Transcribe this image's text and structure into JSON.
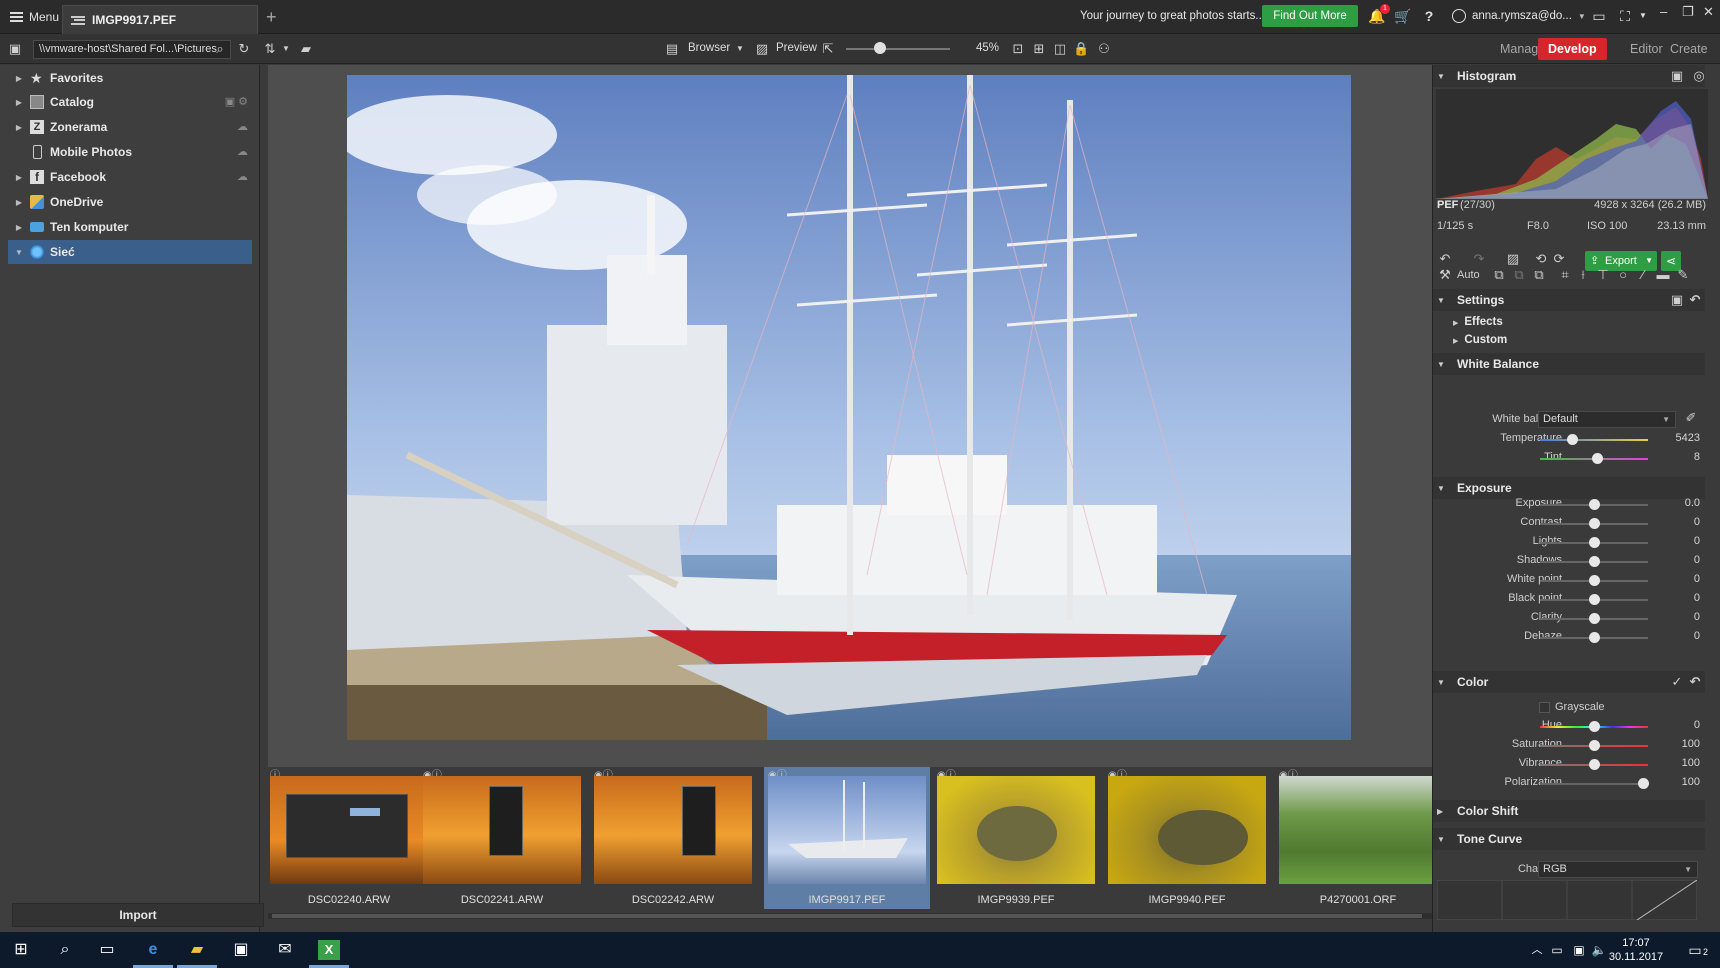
{
  "titlebar": {
    "menu_label": "Menu",
    "doc_tab": "IMGP9917.PEF",
    "add_tab": "+",
    "promo_text": "Your journey to great photos starts...",
    "find_out_more": "Find Out More",
    "notification_count": "1",
    "user_name": "anna.rymsza@do..."
  },
  "toolbar": {
    "path": "\\\\vmware-host\\Shared Fol...\\Pictures",
    "browser_label": "Browser",
    "preview_label": "Preview",
    "zoom_value": "45%",
    "zoom_fraction": 0.33,
    "modes": [
      {
        "label": "Manager",
        "active": false
      },
      {
        "label": "Develop",
        "active": true
      },
      {
        "label": "Editor",
        "active": false
      },
      {
        "label": "Create",
        "active": false
      }
    ]
  },
  "navigator": {
    "items": [
      {
        "label": "Favorites",
        "icon": "star-icon"
      },
      {
        "label": "Catalog",
        "icon": "catalog-icon"
      },
      {
        "label": "Zonerama",
        "icon": "zonerama-icon"
      },
      {
        "label": "Mobile Photos",
        "icon": "phone-icon"
      },
      {
        "label": "Facebook",
        "icon": "facebook-icon"
      },
      {
        "label": "OneDrive",
        "icon": "onedrive-icon"
      },
      {
        "label": "Ten komputer",
        "icon": "computer-icon"
      },
      {
        "label": "Sieć",
        "icon": "network-icon"
      }
    ],
    "import_label": "Import"
  },
  "filmstrip": {
    "items": [
      {
        "name": "DSC02240.ARW",
        "kind": "autumn-dialog"
      },
      {
        "name": "DSC02241.ARW",
        "kind": "autumn-phone"
      },
      {
        "name": "DSC02242.ARW",
        "kind": "autumn-phone"
      },
      {
        "name": "IMGP9917.PEF",
        "kind": "ship",
        "selected": true
      },
      {
        "name": "IMGP9939.PEF",
        "kind": "turtle"
      },
      {
        "name": "IMGP9940.PEF",
        "kind": "turtle"
      },
      {
        "name": "P4270001.ORF",
        "kind": "green"
      }
    ]
  },
  "right_panel": {
    "histogram_title": "Histogram",
    "file_type": "PEF",
    "file_index": "(27/30)",
    "dimensions": "4928 x 3264 (26.2 MB)",
    "shutter": "1/125 s",
    "aperture": "F8.0",
    "iso": "ISO 100",
    "focal": "23.13 mm",
    "export_label": "Export",
    "auto_label": "Auto",
    "settings_title": "Settings",
    "effects_label": "Effects",
    "custom_label": "Custom",
    "white_balance_title": "White Balance",
    "wb_label": "White balance",
    "wb_value": "Default",
    "temperature": {
      "label": "Temperature",
      "value": "5423",
      "pos": 0.3
    },
    "tint": {
      "label": "Tint",
      "value": "8",
      "pos": 0.53
    },
    "exposure_title": "Exposure",
    "exposure_rows": [
      {
        "label": "Exposure",
        "value": "0.0",
        "pos": 0.5
      },
      {
        "label": "Contrast",
        "value": "0",
        "pos": 0.5
      },
      {
        "label": "Lights",
        "value": "0",
        "pos": 0.5
      },
      {
        "label": "Shadows",
        "value": "0",
        "pos": 0.5
      },
      {
        "label": "White point",
        "value": "0",
        "pos": 0.5
      },
      {
        "label": "Black point",
        "value": "0",
        "pos": 0.5
      },
      {
        "label": "Clarity",
        "value": "0",
        "pos": 0.5
      },
      {
        "label": "Dehaze",
        "value": "0",
        "pos": 0.5
      }
    ],
    "color_title": "Color",
    "grayscale_label": "Grayscale",
    "color_rows": [
      {
        "label": "Hue",
        "value": "0",
        "pos": 0.5,
        "gradient": "hue"
      },
      {
        "label": "Saturation",
        "value": "100",
        "pos": 0.5,
        "gradient": "sat"
      },
      {
        "label": "Vibrance",
        "value": "100",
        "pos": 0.5,
        "gradient": "sat"
      },
      {
        "label": "Polarization",
        "value": "100",
        "pos": 0.95,
        "gradient": "none"
      }
    ],
    "color_shift_title": "Color Shift",
    "tone_curve_title": "Tone Curve",
    "channel_label": "Channel:",
    "channel_value": "RGB"
  },
  "taskbar": {
    "time": "17:07",
    "date": "30.11.2017",
    "notif_count": "2"
  },
  "colors": {
    "accent_red": "#d5262b",
    "find_green": "#2e9e44",
    "selection_blue": "#3a5f8a"
  }
}
